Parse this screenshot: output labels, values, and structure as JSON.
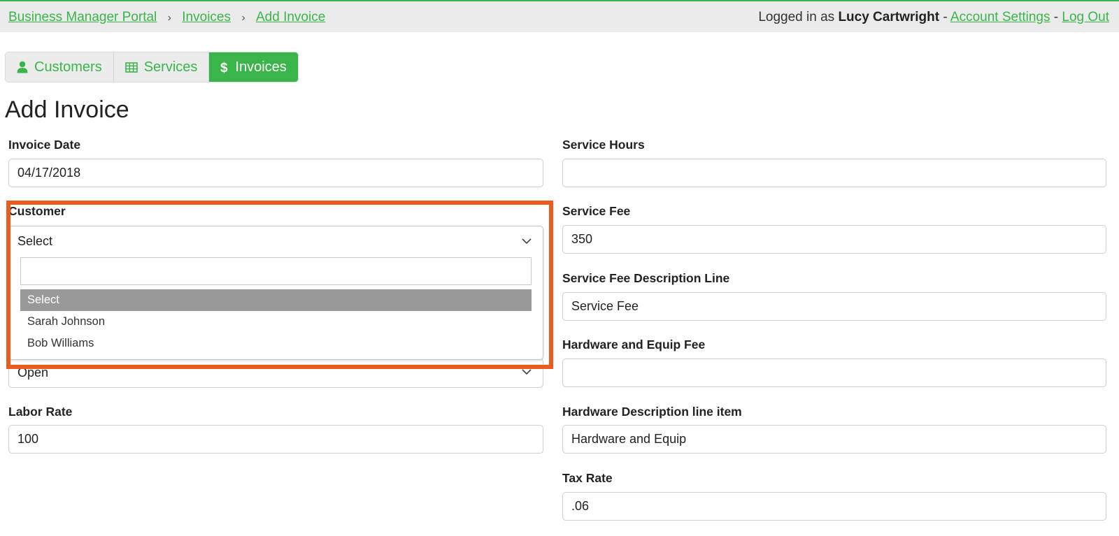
{
  "breadcrumb": {
    "items": [
      "Business Manager Portal",
      "Invoices",
      "Add Invoice"
    ]
  },
  "user": {
    "prefix": "Logged in as",
    "name": "Lucy Cartwright",
    "dash1": "-",
    "settings": "Account Settings",
    "dash2": "-",
    "logout": "Log Out"
  },
  "nav": {
    "tabs": [
      {
        "label": "Customers",
        "icon": "user-icon"
      },
      {
        "label": "Services",
        "icon": "table-icon"
      },
      {
        "label": "Invoices",
        "icon": "dollar-icon",
        "active": true
      }
    ]
  },
  "page_title": "Add Invoice",
  "form": {
    "invoice_date": {
      "label": "Invoice Date",
      "value": "04/17/2018"
    },
    "customer": {
      "label": "Customer",
      "selected": "Select",
      "search_value": "",
      "options": [
        "Select",
        "Sarah Johnson",
        "Bob Williams"
      ]
    },
    "status": {
      "value": "Open"
    },
    "labor_rate": {
      "label": "Labor Rate",
      "value": "100"
    },
    "service_hours": {
      "label": "Service Hours",
      "value": ""
    },
    "service_fee": {
      "label": "Service Fee",
      "value": "350"
    },
    "service_fee_desc": {
      "label": "Service Fee Description Line",
      "value": "Service Fee"
    },
    "hardware_fee": {
      "label": "Hardware and Equip Fee",
      "value": ""
    },
    "hardware_desc": {
      "label": "Hardware Description line item",
      "value": "Hardware and Equip"
    },
    "tax_rate": {
      "label": "Tax Rate",
      "value": ".06"
    }
  },
  "colors": {
    "accent": "#3ab54a",
    "highlight": "#ec5a1d",
    "selected_option": "#999999",
    "topbar": "#ebebeb"
  }
}
